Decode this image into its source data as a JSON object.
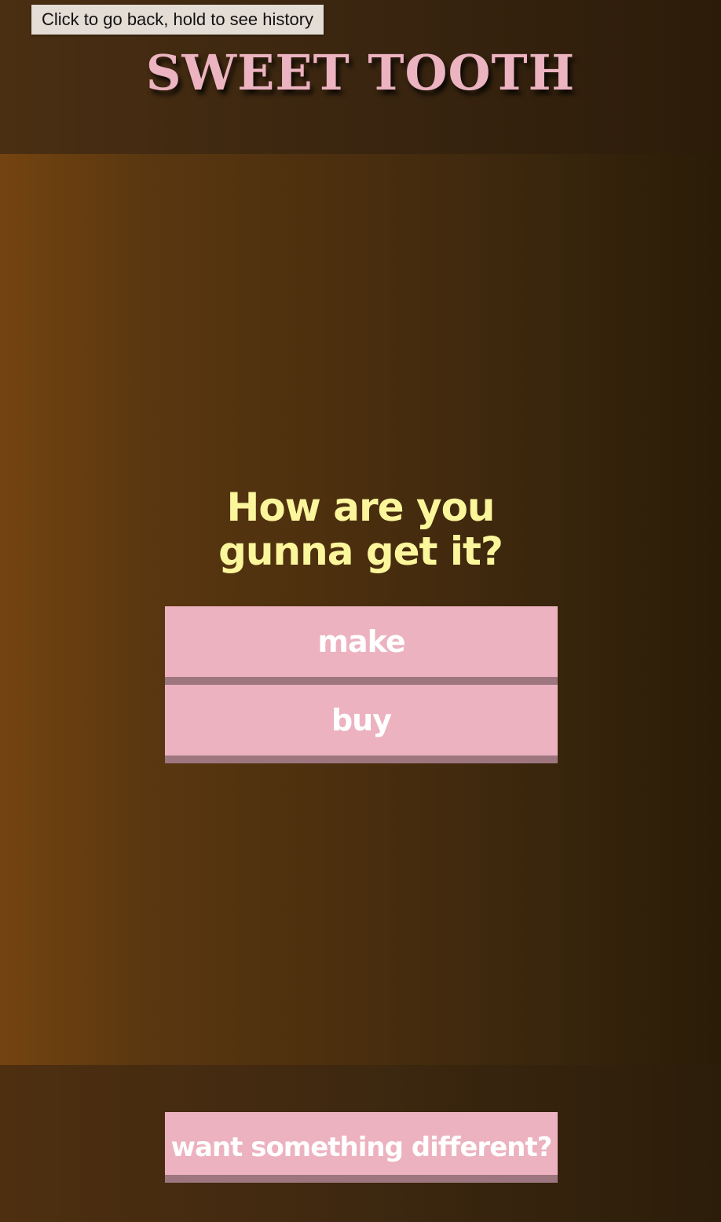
{
  "browser": {
    "tooltip": "Click to go back, hold to see history"
  },
  "header": {
    "title": "SWEET TOOTH"
  },
  "main": {
    "question": "How are you gunna get it?",
    "options": [
      {
        "label": "make"
      },
      {
        "label": "buy"
      }
    ]
  },
  "footer": {
    "different_label": "want something different?"
  },
  "colors": {
    "brand_pink": "#ecb3c1",
    "question_yellow": "#fbf69c",
    "button_pink": "#ecb2bf",
    "button_shadow": "#9e7680"
  }
}
